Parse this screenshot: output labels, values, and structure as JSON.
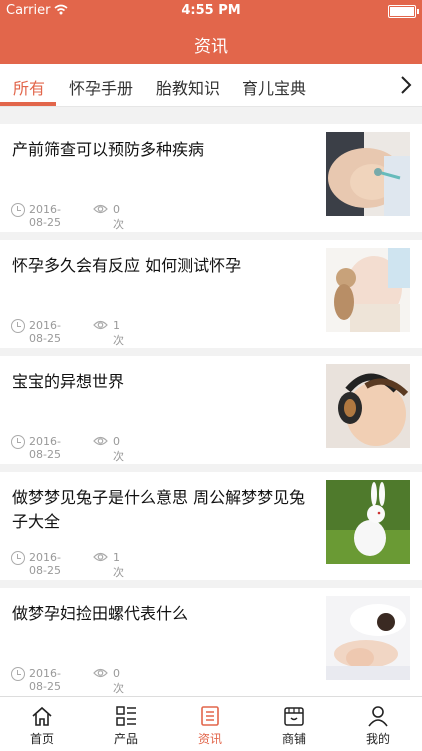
{
  "status_bar": {
    "carrier": "Carrier",
    "time": "4:55 PM"
  },
  "nav": {
    "title": "资讯"
  },
  "tabs": [
    {
      "label": "所有",
      "active": true
    },
    {
      "label": "怀孕手册",
      "active": false
    },
    {
      "label": "胎教知识",
      "active": false
    },
    {
      "label": "育儿宝典",
      "active": false
    }
  ],
  "articles": [
    {
      "title": "产前筛查可以预防多种疾病",
      "date": "2016-08-25",
      "views": "0次",
      "thumb": "pregnant-belly-checkup"
    },
    {
      "title": "怀孕多久会有反应 如何测试怀孕",
      "date": "2016-08-25",
      "views": "1次",
      "thumb": "pregnant-belly-teddy-bear"
    },
    {
      "title": "宝宝的异想世界",
      "date": "2016-08-25",
      "views": "0次",
      "thumb": "baby-with-headphones"
    },
    {
      "title": "做梦梦见兔子是什么意思 周公解梦梦见兔子大全",
      "date": "2016-08-25",
      "views": "1次",
      "thumb": "white-rabbit-on-grass"
    },
    {
      "title": "做梦孕妇捡田螺代表什么",
      "date": "2016-08-25",
      "views": "0次",
      "thumb": "sleeping-pregnant-woman"
    }
  ],
  "tab_bar": [
    {
      "label": "首页",
      "icon": "home-icon",
      "active": false
    },
    {
      "label": "产品",
      "icon": "product-list-icon",
      "active": false
    },
    {
      "label": "资讯",
      "icon": "news-icon",
      "active": true
    },
    {
      "label": "商铺",
      "icon": "shop-icon",
      "active": false
    },
    {
      "label": "我的",
      "icon": "user-icon",
      "active": false
    }
  ],
  "colors": {
    "accent": "#e2664b",
    "background": "#f2f2f2",
    "text": "#111111",
    "meta_text": "#999999"
  }
}
